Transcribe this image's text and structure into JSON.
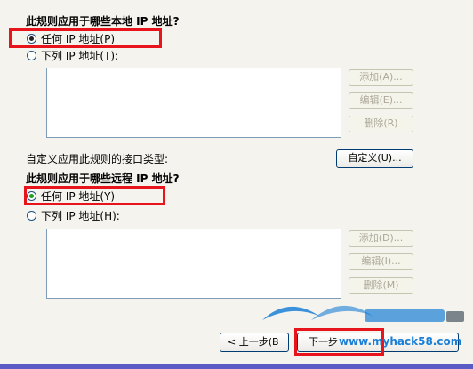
{
  "local_section": {
    "heading": "此规则应用于哪些本地 IP 地址?",
    "radio_any_label": "任何 IP 地址(P)",
    "radio_list_label": "下列 IP 地址(T):",
    "add_label": "添加(A)...",
    "edit_label": "编辑(E)...",
    "remove_label": "删除(R)"
  },
  "interface_section": {
    "label": "自定义应用此规则的接口类型:",
    "customize_label": "自定义(U)..."
  },
  "remote_section": {
    "heading": "此规则应用于哪些远程 IP 地址?",
    "radio_any_label": "任何 IP 地址(Y)",
    "radio_list_label": "下列 IP 地址(H):",
    "add_label": "添加(D)...",
    "edit_label": "编辑(I)...",
    "remove_label": "删除(M)"
  },
  "nav": {
    "back_label": "< 上一步(B",
    "next_label": "下一步"
  },
  "watermark": {
    "url": "www.myhack58.com"
  },
  "colors": {
    "highlight_box": "#e8141b",
    "radio_checked": "#21a121",
    "watermark": "#1a7fd6"
  }
}
